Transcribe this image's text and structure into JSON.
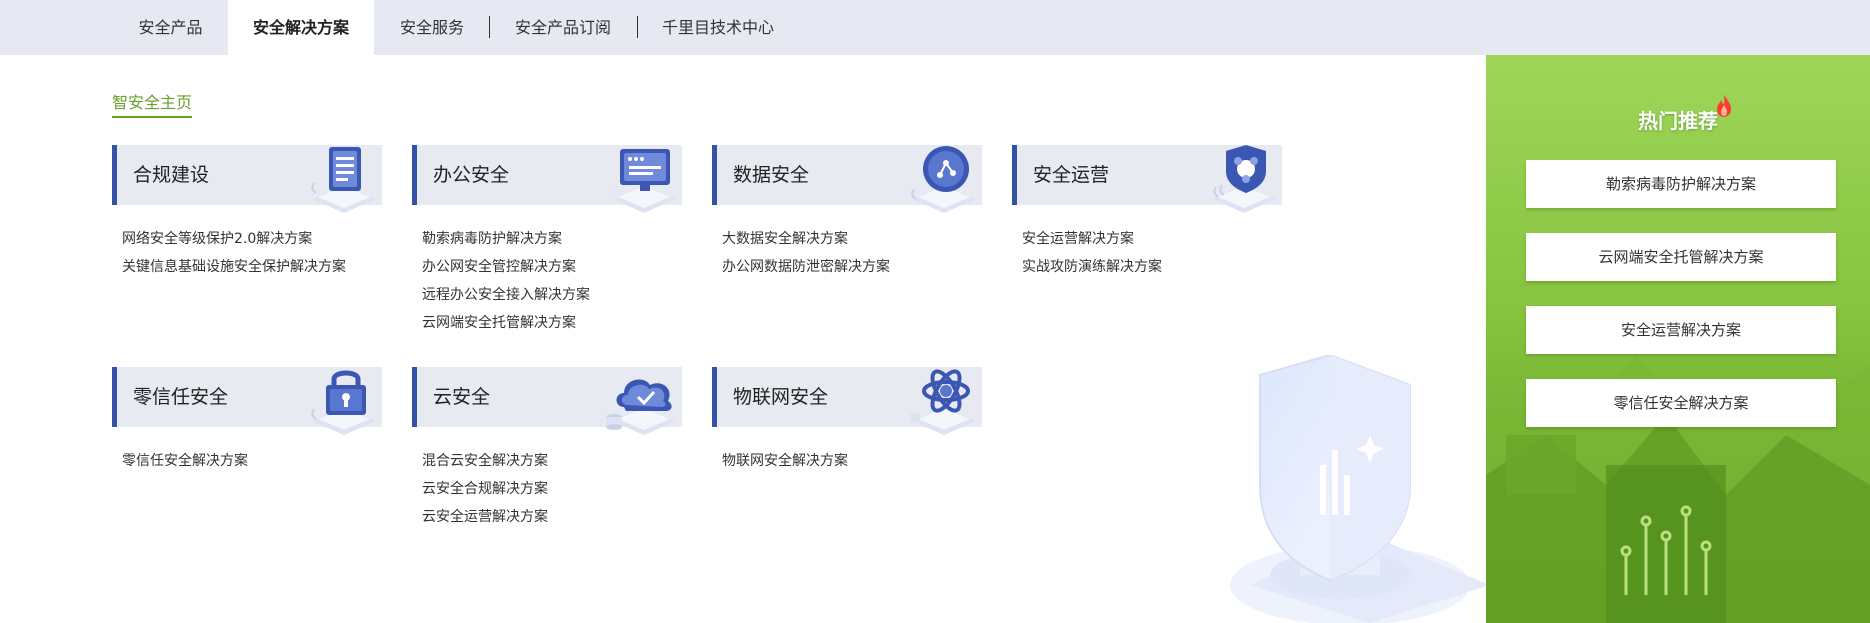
{
  "tabs": [
    {
      "label": "安全产品",
      "active": false
    },
    {
      "label": "安全解决方案",
      "active": true
    },
    {
      "label": "安全服务",
      "active": false
    },
    {
      "label": "安全产品订阅",
      "active": false
    },
    {
      "label": "千里目技术中心",
      "active": false
    }
  ],
  "home_link": "智安全主页",
  "categories": [
    {
      "title": "合规建设",
      "icon": "clipboard-icon",
      "links": [
        "网络安全等级保护2.0解决方案",
        "关键信息基础设施安全保护解决方案"
      ]
    },
    {
      "title": "办公安全",
      "icon": "monitor-icon",
      "links": [
        "勒索病毒防护解决方案",
        "办公网安全管控解决方案",
        "远程办公安全接入解决方案",
        "云网端安全托管解决方案"
      ]
    },
    {
      "title": "数据安全",
      "icon": "data-share-icon",
      "links": [
        "大数据安全解决方案",
        "办公网数据防泄密解决方案"
      ]
    },
    {
      "title": "安全运营",
      "icon": "security-operations-icon",
      "links": [
        "安全运营解决方案",
        "实战攻防演练解决方案"
      ]
    },
    {
      "title": "零信任安全",
      "icon": "padlock-icon",
      "links": [
        "零信任安全解决方案"
      ]
    },
    {
      "title": "云安全",
      "icon": "cloud-check-icon",
      "links": [
        "混合云安全解决方案",
        "云安全合规解决方案",
        "云安全运营解决方案"
      ]
    },
    {
      "title": "物联网安全",
      "icon": "iot-atom-icon",
      "links": [
        "物联网安全解决方案"
      ]
    }
  ],
  "hot": {
    "title": "热门推荐",
    "icon": "fire-icon",
    "items": [
      "勒索病毒防护解决方案",
      "云网端安全托管解决方案",
      "安全运营解决方案",
      "零信任安全解决方案"
    ]
  },
  "colors": {
    "accent_blue": "#3551a7",
    "link_green": "#6aa12c",
    "panel_green": "#86c33e",
    "tabbar_bg": "#e6e9f1",
    "card_head_bg": "#e8eaf2"
  }
}
